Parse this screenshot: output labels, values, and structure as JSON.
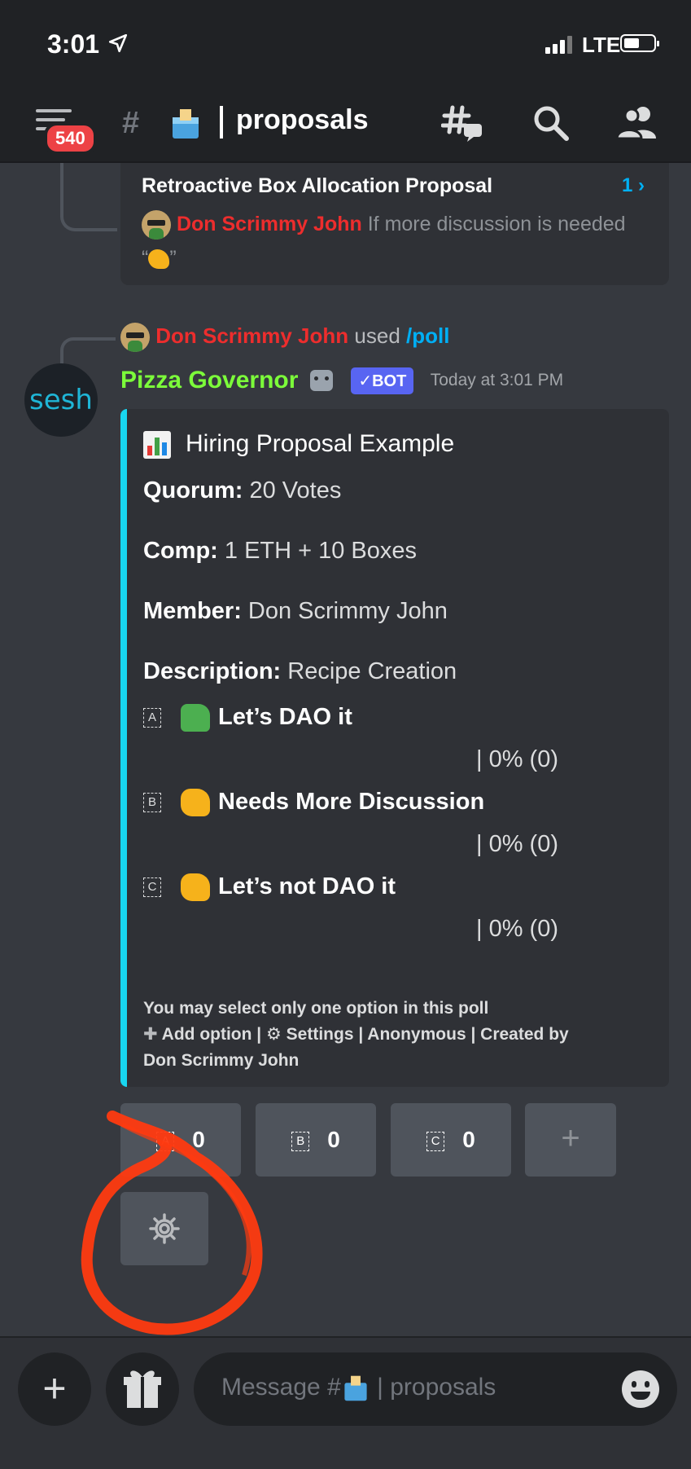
{
  "status_bar": {
    "time": "3:01",
    "carrier": "LTE"
  },
  "header": {
    "badge_count": "540",
    "separator": "|",
    "channel_name": "proposals"
  },
  "thread": {
    "title": "Retroactive Box Allocation Proposal",
    "count": "1 ›",
    "author": "Don Scrimmy John",
    "preview": " If more discussion is needed “",
    "preview_end": "”"
  },
  "reply": {
    "user": "Don Scrimmy John",
    "used": " used ",
    "command": "/poll"
  },
  "message": {
    "avatar_text": "sesh",
    "author": "Pizza Governor",
    "bot_tag": "✓BOT",
    "timestamp": "Today at 3:01 PM"
  },
  "embed": {
    "accent_color": "#18d6f0",
    "title": "Hiring Proposal Example",
    "fields": [
      {
        "label": "Quorum:",
        "value": " 20 Votes"
      },
      {
        "label": "Comp:",
        "value": " 1 ETH + 10 Boxes"
      },
      {
        "label": "Member:",
        "value": " Don Scrimmy John"
      },
      {
        "label": "Description:",
        "value": " Recipe Creation"
      }
    ],
    "options": [
      {
        "letter": "A",
        "label": "Let’s DAO it",
        "result": "| 0% (0)",
        "icon": "thumbs-up"
      },
      {
        "letter": "B",
        "label": "Needs More Discussion",
        "result": "| 0% (0)",
        "icon": "pinching-hand"
      },
      {
        "letter": "C",
        "label": "Let’s not DAO it",
        "result": "| 0% (0)",
        "icon": "thumbs-down"
      }
    ],
    "footer_line1": "You may select only one option in this poll",
    "footer_line2": " Add option | ",
    "footer_line2b": " Settings | Anonymous | Created by",
    "footer_line3": "Don Scrimmy John"
  },
  "buttons": {
    "vote": [
      {
        "letter": "A",
        "count": "0"
      },
      {
        "letter": "B",
        "count": "0"
      },
      {
        "letter": "C",
        "count": "0"
      }
    ],
    "add": "+"
  },
  "composer": {
    "placeholder_prefix": "Message #",
    "placeholder_suffix": " | proposals",
    "plus": "+"
  },
  "colors": {
    "background": "#36393f",
    "header": "#202225",
    "author_red": "#ed2d2d",
    "bot_green": "#7cfc3a",
    "blurple": "#5865f2",
    "annotation": "#ff3a10"
  }
}
